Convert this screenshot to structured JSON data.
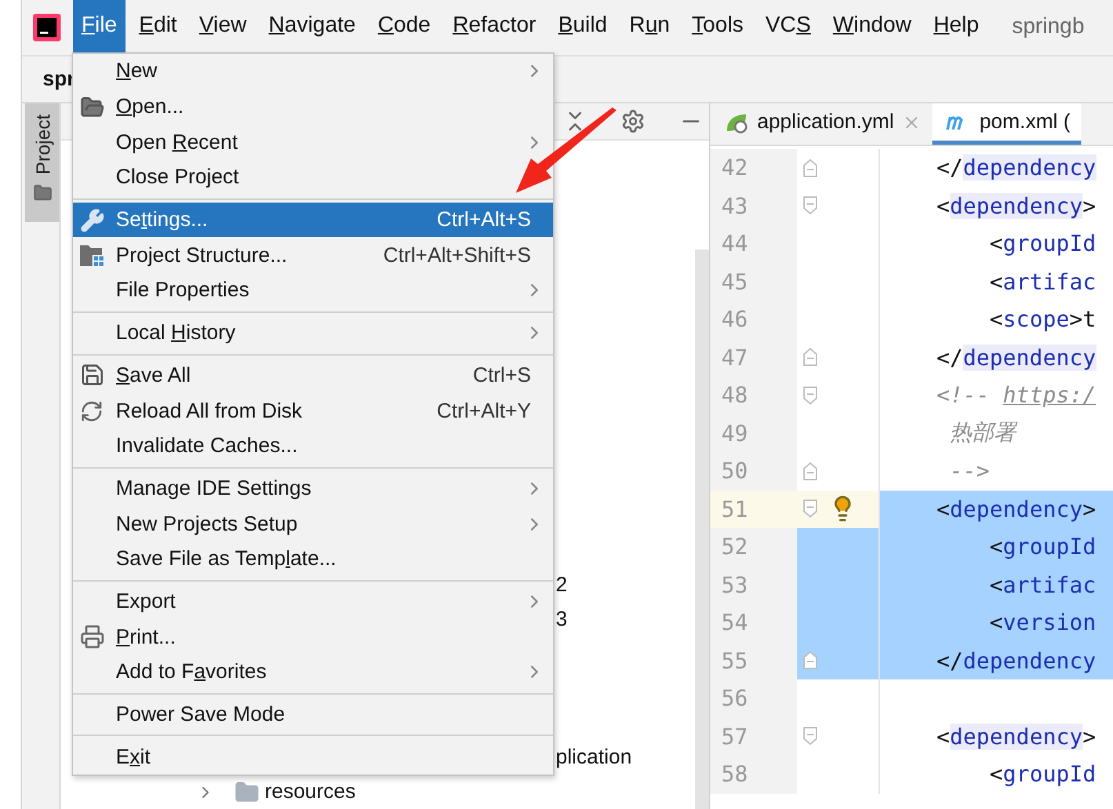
{
  "menu_bar": {
    "items": [
      {
        "key": "F",
        "post": "ile",
        "selected": true
      },
      {
        "key": "E",
        "post": "dit",
        "selected": false
      },
      {
        "key": "V",
        "post": "iew",
        "selected": false
      },
      {
        "key": "N",
        "post": "avigate",
        "selected": false
      },
      {
        "key": "C",
        "post": "ode",
        "selected": false
      },
      {
        "key": "R",
        "post": "efactor",
        "selected": false
      },
      {
        "key": "B",
        "post": "uild",
        "selected": false
      },
      {
        "pre": "R",
        "key": "u",
        "post": "n",
        "selected": false
      },
      {
        "key": "T",
        "post": "ools",
        "selected": false
      },
      {
        "pre": "VC",
        "key": "S",
        "selected": false
      },
      {
        "key": "W",
        "post": "indow",
        "selected": false
      },
      {
        "key": "H",
        "post": "elp",
        "selected": false
      }
    ],
    "project_title": "springb"
  },
  "breadcrumb": "spr",
  "tool_window_tab": {
    "label": "Project",
    "selected": true
  },
  "project_tree": [
    {
      "text": "2",
      "kind": "fragment"
    },
    {
      "text": "3",
      "kind": "fragment"
    },
    {
      "text": "plication",
      "kind": "fragment"
    },
    {
      "text": "resources",
      "kind": "folder",
      "expanded": false
    }
  ],
  "editor_tabs": [
    {
      "label": "application.yml",
      "kind": "yaml",
      "selected": false
    },
    {
      "label": "pom.xml (",
      "kind": "maven",
      "selected": true
    }
  ],
  "editor_lines": [
    {
      "number": "42",
      "fold_end": true,
      "tokens": [
        {
          "text": "</",
          "kind": "punct"
        },
        {
          "text": "dependency",
          "kind": "tag",
          "matched": true
        }
      ]
    },
    {
      "number": "43",
      "fold_start": true,
      "tokens": [
        {
          "text": "<",
          "kind": "punct"
        },
        {
          "text": "dependency",
          "kind": "tag",
          "matched": true
        },
        {
          "text": ">",
          "kind": "punct"
        }
      ]
    },
    {
      "number": "44",
      "tokens": [
        {
          "text": "    <",
          "kind": "punct"
        },
        {
          "text": "groupId",
          "kind": "tag"
        }
      ]
    },
    {
      "number": "45",
      "tokens": [
        {
          "text": "    <",
          "kind": "punct"
        },
        {
          "text": "artifac",
          "kind": "tag"
        }
      ]
    },
    {
      "number": "46",
      "tokens": [
        {
          "text": "    <",
          "kind": "punct"
        },
        {
          "text": "scope",
          "kind": "tag"
        },
        {
          "text": ">t",
          "kind": "punct"
        }
      ]
    },
    {
      "number": "47",
      "fold_end": true,
      "tokens": [
        {
          "text": "</",
          "kind": "punct"
        },
        {
          "text": "dependency",
          "kind": "tag",
          "matched": true
        }
      ]
    },
    {
      "number": "48",
      "fold_start": true,
      "tokens": [
        {
          "text": "<!-- ",
          "kind": "comment"
        },
        {
          "text": "https:/",
          "kind": "link"
        }
      ]
    },
    {
      "number": "49",
      "tokens": [
        {
          "text": " 热部署",
          "kind": "comment"
        }
      ]
    },
    {
      "number": "50",
      "fold_end": true,
      "tokens": [
        {
          "text": " -->",
          "kind": "comment"
        }
      ]
    },
    {
      "number": "51",
      "fold_start": true,
      "current": true,
      "selected": true,
      "bulb": true,
      "tokens": [
        {
          "text": "<",
          "kind": "punct"
        },
        {
          "text": "dependency",
          "kind": "tag"
        },
        {
          "text": ">",
          "kind": "punct"
        }
      ]
    },
    {
      "number": "52",
      "selected": true,
      "tokens": [
        {
          "text": "    <",
          "kind": "punct"
        },
        {
          "text": "groupId",
          "kind": "tag"
        }
      ]
    },
    {
      "number": "53",
      "selected": true,
      "tokens": [
        {
          "text": "    <",
          "kind": "punct"
        },
        {
          "text": "artifac",
          "kind": "tag"
        }
      ]
    },
    {
      "number": "54",
      "selected": true,
      "tokens": [
        {
          "text": "    <",
          "kind": "punct"
        },
        {
          "text": "version",
          "kind": "tag"
        }
      ]
    },
    {
      "number": "55",
      "fold_end": true,
      "selected": true,
      "tokens": [
        {
          "text": "</",
          "kind": "punct"
        },
        {
          "text": "dependency",
          "kind": "tag"
        }
      ]
    },
    {
      "number": "56"
    },
    {
      "number": "57",
      "fold_start": true,
      "tokens": [
        {
          "text": "<",
          "kind": "punct"
        },
        {
          "text": "dependency",
          "kind": "tag",
          "matched": true
        },
        {
          "text": ">",
          "kind": "punct"
        }
      ]
    },
    {
      "number": "58",
      "tokens": [
        {
          "text": "    <",
          "kind": "punct"
        },
        {
          "text": "groupId",
          "kind": "tag"
        }
      ]
    }
  ],
  "file_menu": {
    "groups": [
      [
        {
          "key": "N",
          "post": "ew",
          "submenu": true,
          "selected": false
        },
        {
          "key": "O",
          "post": "pen...",
          "kind": "open",
          "selected": false
        },
        {
          "pre": "Open ",
          "key": "R",
          "post": "ecent",
          "submenu": true,
          "selected": false
        },
        {
          "pre": "Close Project",
          "selected": false
        }
      ],
      [
        {
          "pre": "Se",
          "key": "t",
          "post": "tings...",
          "kind": "settings",
          "shortcut": "Ctrl+Alt+S",
          "selected": true
        },
        {
          "pre": "Project Structure...",
          "kind": "structure",
          "shortcut": "Ctrl+Alt+Shift+S",
          "selected": false
        },
        {
          "pre": "File Properties",
          "submenu": true,
          "selected": false
        }
      ],
      [
        {
          "pre": "Local ",
          "key": "H",
          "post": "istory",
          "submenu": true,
          "selected": false
        }
      ],
      [
        {
          "key": "S",
          "post": "ave All",
          "kind": "save",
          "shortcut": "Ctrl+S",
          "selected": false
        },
        {
          "pre": "Reload All from Disk",
          "kind": "reload",
          "shortcut": "Ctrl+Alt+Y",
          "selected": false
        },
        {
          "pre": "Invalidate Caches...",
          "selected": false
        }
      ],
      [
        {
          "pre": "Manage IDE Settings",
          "submenu": true,
          "selected": false
        },
        {
          "pre": "New Projects Setup",
          "submenu": true,
          "selected": false
        },
        {
          "pre": "Save File as Temp",
          "key": "l",
          "post": "ate...",
          "selected": false
        }
      ],
      [
        {
          "pre": "Export",
          "submenu": true,
          "selected": false
        },
        {
          "key": "P",
          "post": "rint...",
          "kind": "print",
          "selected": false
        },
        {
          "pre": "Add to F",
          "key": "a",
          "post": "vorites",
          "submenu": true,
          "selected": false
        }
      ],
      [
        {
          "pre": "Power Save Mode",
          "selected": false
        }
      ],
      [
        {
          "pre": "E",
          "key": "x",
          "post": "it",
          "selected": false
        }
      ]
    ]
  }
}
